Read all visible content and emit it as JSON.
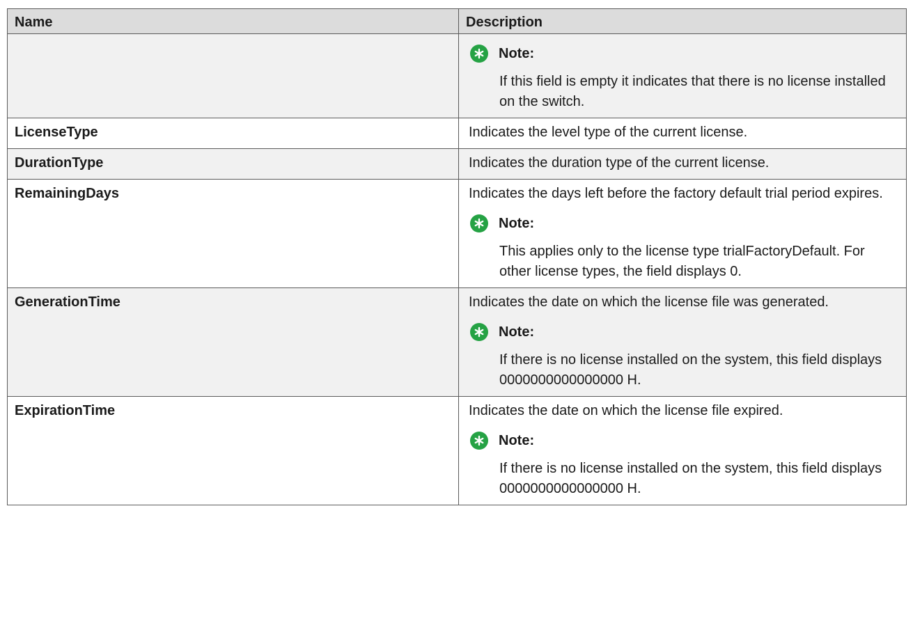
{
  "table": {
    "headers": {
      "name": "Name",
      "description": "Description"
    },
    "note_label": "Note:",
    "rows": [
      {
        "name": "",
        "text": "",
        "note": "If this field is empty it indicates that there is no license installed on the switch."
      },
      {
        "name": "LicenseType",
        "text": "Indicates the level type of the current license.",
        "note": ""
      },
      {
        "name": "DurationType",
        "text": "Indicates the duration type of the current license.",
        "note": ""
      },
      {
        "name": "RemainingDays",
        "text": "Indicates the days left before the factory default trial period expires.",
        "note": "This applies only to the license type trialFactoryDefault. For other license types, the field displays 0."
      },
      {
        "name": "GenerationTime",
        "text": "Indicates the date on which the license file was generated.",
        "note": "If there is no license installed on the system, this field displays 0000000000000000 H."
      },
      {
        "name": "ExpirationTime",
        "text": "Indicates the date on which the license file expired.",
        "note": "If there is no license installed on the system, this field displays 0000000000000000 H."
      }
    ]
  },
  "colors": {
    "header_bg": "#dcdcdc",
    "row_shade": "#f1f1f1",
    "note_icon": "#25a244",
    "border": "#5a5a5a"
  },
  "icons": {
    "note": "asterisk-note-icon"
  }
}
